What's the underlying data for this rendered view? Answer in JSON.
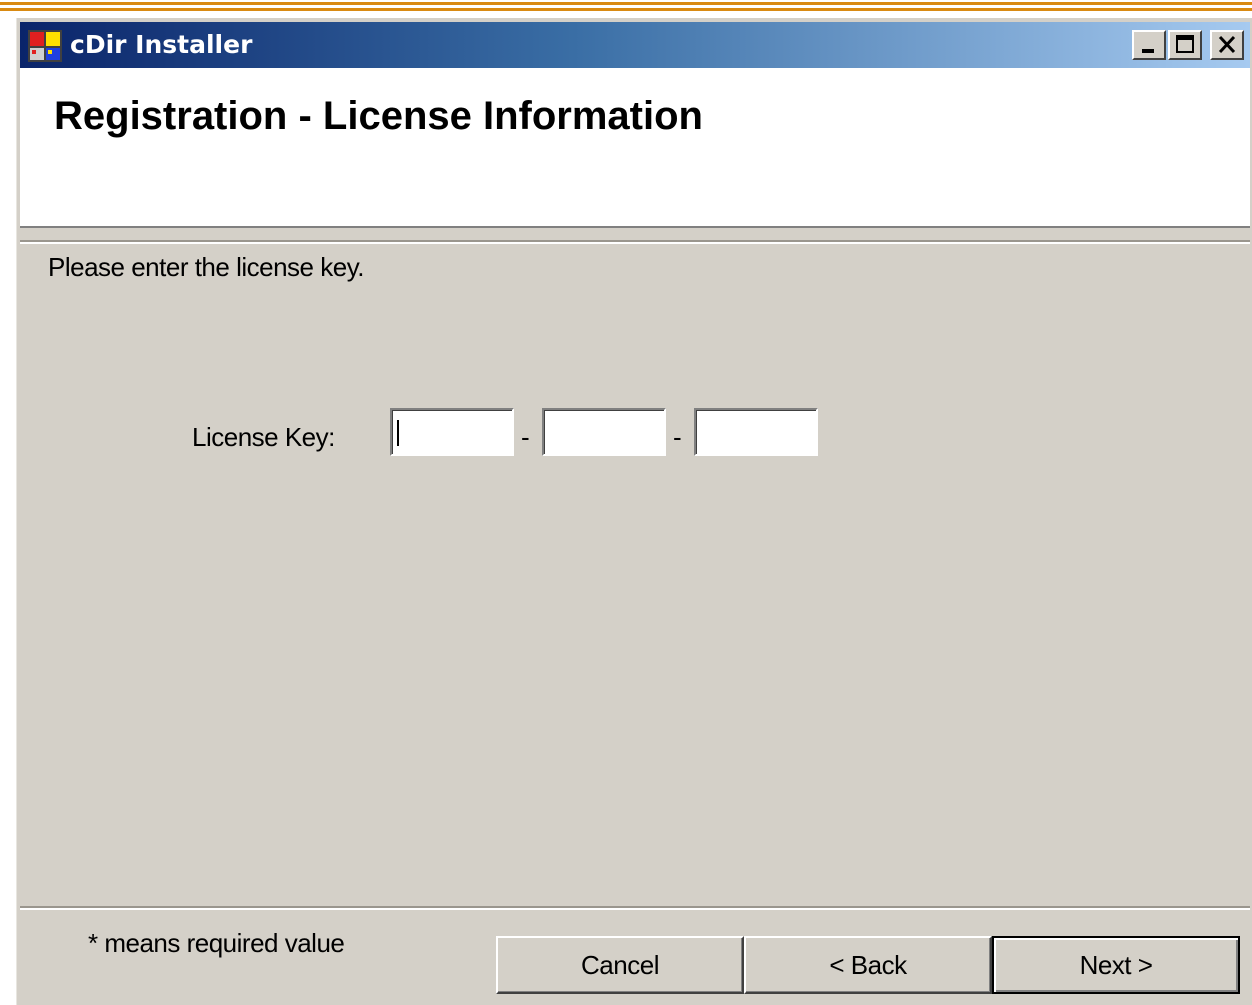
{
  "window": {
    "title": "cDir Installer",
    "controls": {
      "minimize_icon": "minimize-icon",
      "maximize_icon": "maximize-icon",
      "close_icon": "close-icon"
    }
  },
  "header": {
    "title": "Registration - License Information"
  },
  "body": {
    "instruction": "Please enter the license key.",
    "license_key": {
      "label": "License Key:",
      "separator": "-",
      "parts": [
        {
          "value": "",
          "placeholder": ""
        },
        {
          "value": "",
          "placeholder": ""
        },
        {
          "value": "",
          "placeholder": ""
        }
      ]
    }
  },
  "footer": {
    "required_note": "* means required value",
    "buttons": {
      "cancel": "Cancel",
      "back": "< Back",
      "next": "Next >"
    }
  },
  "colors": {
    "title_gradient_start": "#0a246a",
    "title_gradient_end": "#a6caf0",
    "dialog_face": "#d4d0c8",
    "desktop_stripe": "#d98a12"
  }
}
